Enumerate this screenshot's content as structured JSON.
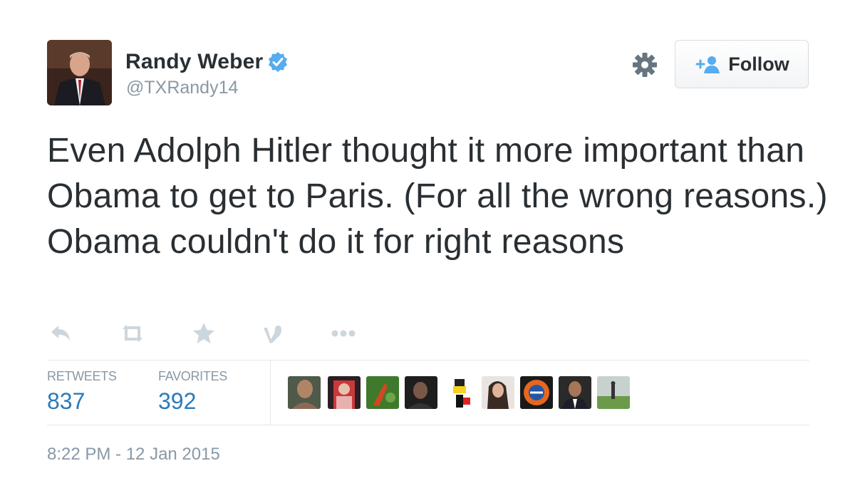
{
  "user": {
    "display_name": "Randy Weber",
    "handle": "@TXRandy14",
    "verified": true
  },
  "follow_button": {
    "label": "Follow",
    "icon": "follow-add-user-icon"
  },
  "settings_icon": "gear-icon",
  "tweet": {
    "text": "Even Adolph Hitler thought it more important than Obama to get to Paris. (For all the wrong reasons.) Obama couldn't do it for right reasons",
    "timestamp": "8:22 PM - 12 Jan 2015"
  },
  "actions": [
    {
      "name": "reply-icon"
    },
    {
      "name": "retweet-icon"
    },
    {
      "name": "favorite-star-icon"
    },
    {
      "name": "vine-icon"
    },
    {
      "name": "more-dots-icon"
    }
  ],
  "stats": {
    "retweets_label": "RETWEETS",
    "retweets_count": "837",
    "favorites_label": "FAVORITES",
    "favorites_count": "392"
  },
  "favoriters": [
    {
      "name": "favoriter-avatar-1"
    },
    {
      "name": "favoriter-avatar-2"
    },
    {
      "name": "favoriter-avatar-3"
    },
    {
      "name": "favoriter-avatar-4"
    },
    {
      "name": "favoriter-avatar-5"
    },
    {
      "name": "favoriter-avatar-6"
    },
    {
      "name": "favoriter-avatar-7"
    },
    {
      "name": "favoriter-avatar-8"
    },
    {
      "name": "favoriter-avatar-9"
    }
  ],
  "colors": {
    "link_blue": "#2b7bb9",
    "muted_gray": "#8899a6",
    "icon_gray": "#ccd6dd",
    "verified_blue": "#55acee"
  }
}
